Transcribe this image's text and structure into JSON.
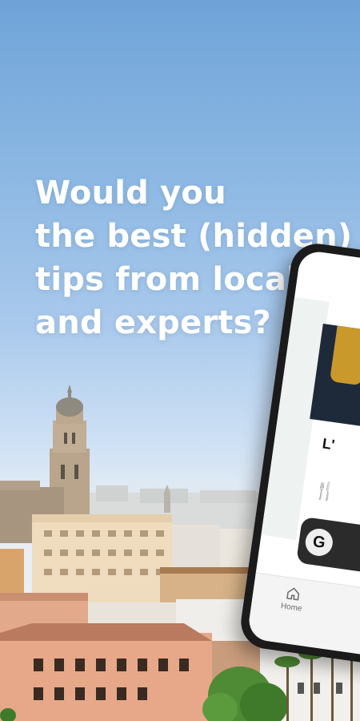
{
  "headline": {
    "lines": [
      "Would you",
      "the best (hidden)",
      "tips from locals",
      "and experts?"
    ]
  },
  "phone": {
    "partial_title": "L'",
    "fork_icon": "fork-knife-icon",
    "go_button_letter": "G",
    "tab_home_label": "Home",
    "tab_home_icon": "home-icon"
  },
  "colors": {
    "sky_top": "#6fa3d8",
    "sky_mid": "#a9c9ec",
    "headline_text": "#ffffff",
    "phone_frame": "#1b1b1b",
    "button_dark": "#2b2b2b"
  }
}
